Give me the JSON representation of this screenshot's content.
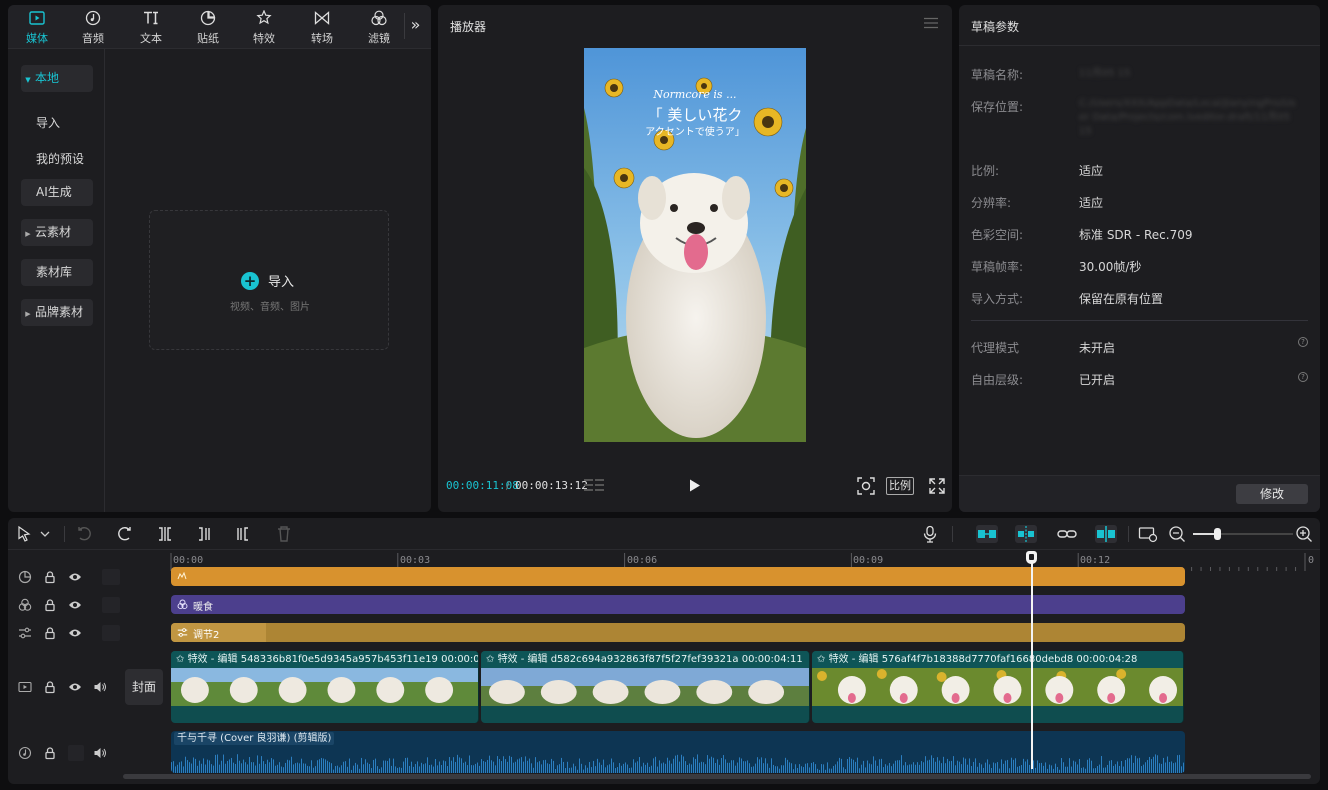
{
  "media_tabs": [
    {
      "label": "媒体",
      "icon": "media-icon"
    },
    {
      "label": "音频",
      "icon": "audio-icon"
    },
    {
      "label": "文本",
      "icon": "text-icon"
    },
    {
      "label": "贴纸",
      "icon": "sticker-icon"
    },
    {
      "label": "特效",
      "icon": "effects-icon"
    },
    {
      "label": "转场",
      "icon": "transition-icon"
    },
    {
      "label": "滤镜",
      "icon": "filter-icon"
    }
  ],
  "more_label": "»",
  "sidebar": {
    "local": "本地",
    "import": "导入",
    "presets": "我的预设",
    "ai": "AI生成",
    "cloud": "云素材",
    "library": "素材库",
    "brand": "品牌素材"
  },
  "importbox": {
    "label": "导入",
    "sub": "视频、音频、图片"
  },
  "player": {
    "title": "播放器",
    "current_time": "00:00:11:08",
    "total_time": "00:00:13:12",
    "ratio_label": "比例",
    "overlay_line1": "Normcore is ...",
    "overlay_line2": "「 美しい花ク",
    "overlay_line3": "アクセントで使うア」"
  },
  "props": {
    "title": "草稿参数",
    "name_label": "草稿名称:",
    "name_value": "11月05 15",
    "path_label": "保存位置:",
    "path_value": "C:/Users/XXX/AppData/Local/JianyingPro/User Data/Projects/com.lveditor.draft/11月05 15",
    "ratio_label": "比例:",
    "ratio_value": "适应",
    "res_label": "分辨率:",
    "res_value": "适应",
    "color_label": "色彩空间:",
    "color_value": "标准 SDR - Rec.709",
    "fps_label": "草稿帧率:",
    "fps_value": "30.00帧/秒",
    "import_label": "导入方式:",
    "import_value": "保留在原有位置",
    "proxy_label": "代理模式",
    "proxy_value": "未开启",
    "layer_label": "自由层级:",
    "layer_value": "已开启",
    "modify_button": "修改"
  },
  "timeline": {
    "ruler": [
      "00:00",
      "00:03",
      "00:06",
      "00:09",
      "00:12",
      "0"
    ],
    "effect_track_label": "",
    "filter_track_label": "暖食",
    "adjust_track_label": "调节2",
    "cover_label": "封面",
    "video_clips": [
      {
        "label": "特效 - 编辑  548336b81f0e5d9345a957b453f11e19  00:00:0"
      },
      {
        "label": "特效 - 编辑  d582c694a932863f87f5f27fef39321a  00:00:04:11"
      },
      {
        "label": "特效 - 编辑  576af4f7b18388d7770faf16680debd8  00:00:04:28"
      }
    ],
    "audio_label": "千与千寻 (Cover 良羽谦) (剪辑版)"
  },
  "colors": {
    "accent": "#19c3d1",
    "effect_track": "#d8922e",
    "filter_track": "#4c3f8d",
    "adjust_track": "#ad8534",
    "video_track": "#0f4d4f",
    "audio_track": "#0d3553"
  }
}
